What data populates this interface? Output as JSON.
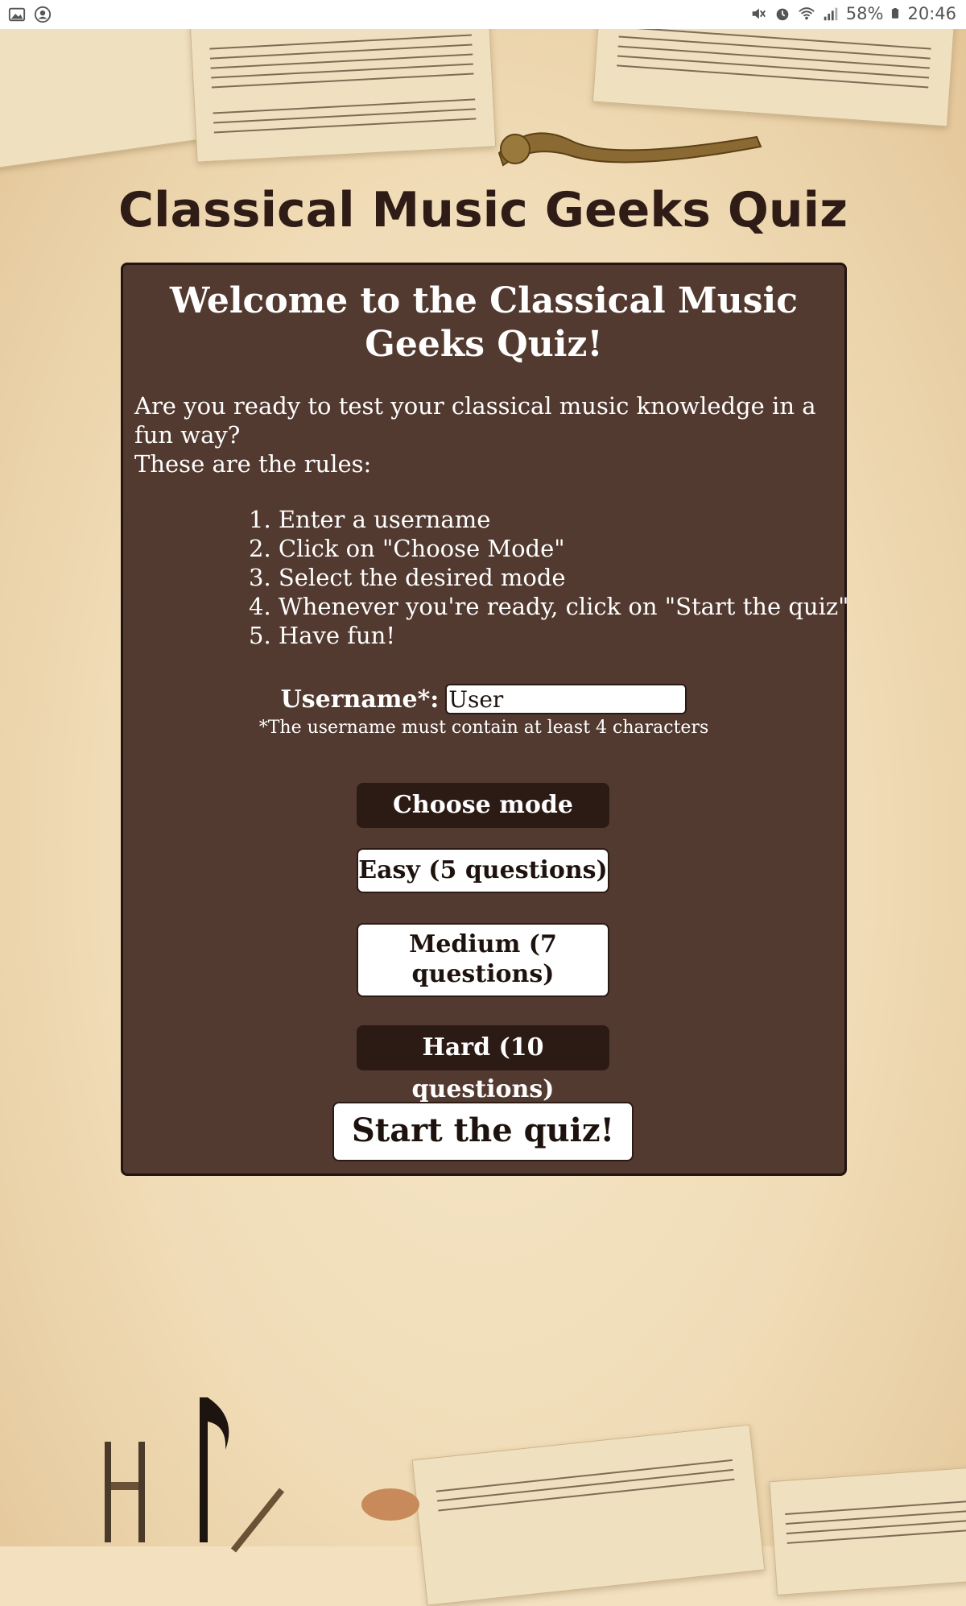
{
  "status_bar": {
    "battery": "58%",
    "time": "20:46",
    "left_icons": [
      "image-icon",
      "account-circle-icon"
    ],
    "right_icons": [
      "mute-icon",
      "alarm-icon",
      "wifi-icon",
      "signal-icon",
      "battery-icon"
    ]
  },
  "header": {
    "title": "Classical Music Geeks Quiz"
  },
  "card": {
    "title": "Welcome to the Classical Music Geeks Quiz!",
    "intro_line1": "Are you ready to test your classical music knowledge in a fun way?",
    "intro_line2": "These are the rules:",
    "rules": [
      "1. Enter a username",
      "2. Click on \"Choose Mode\"",
      "3. Select the desired mode",
      "4. Whenever you're ready, click on \"Start the quiz\"",
      "5. Have fun!"
    ]
  },
  "form": {
    "username_label": "Username*:",
    "username_value": "User",
    "username_hint": "*The username must contain at least 4 characters",
    "choose_mode_label": "Choose mode",
    "modes": {
      "easy": "Easy (5 questions)",
      "medium": "Medium (7 questions)",
      "hard": "Hard (10 questions)"
    },
    "start_label": "Start the quiz!"
  },
  "colors": {
    "card_bg": "#533a30",
    "dark_button": "#2c1a15",
    "title_text": "#2f1c16",
    "background": "#f2e0bf"
  }
}
